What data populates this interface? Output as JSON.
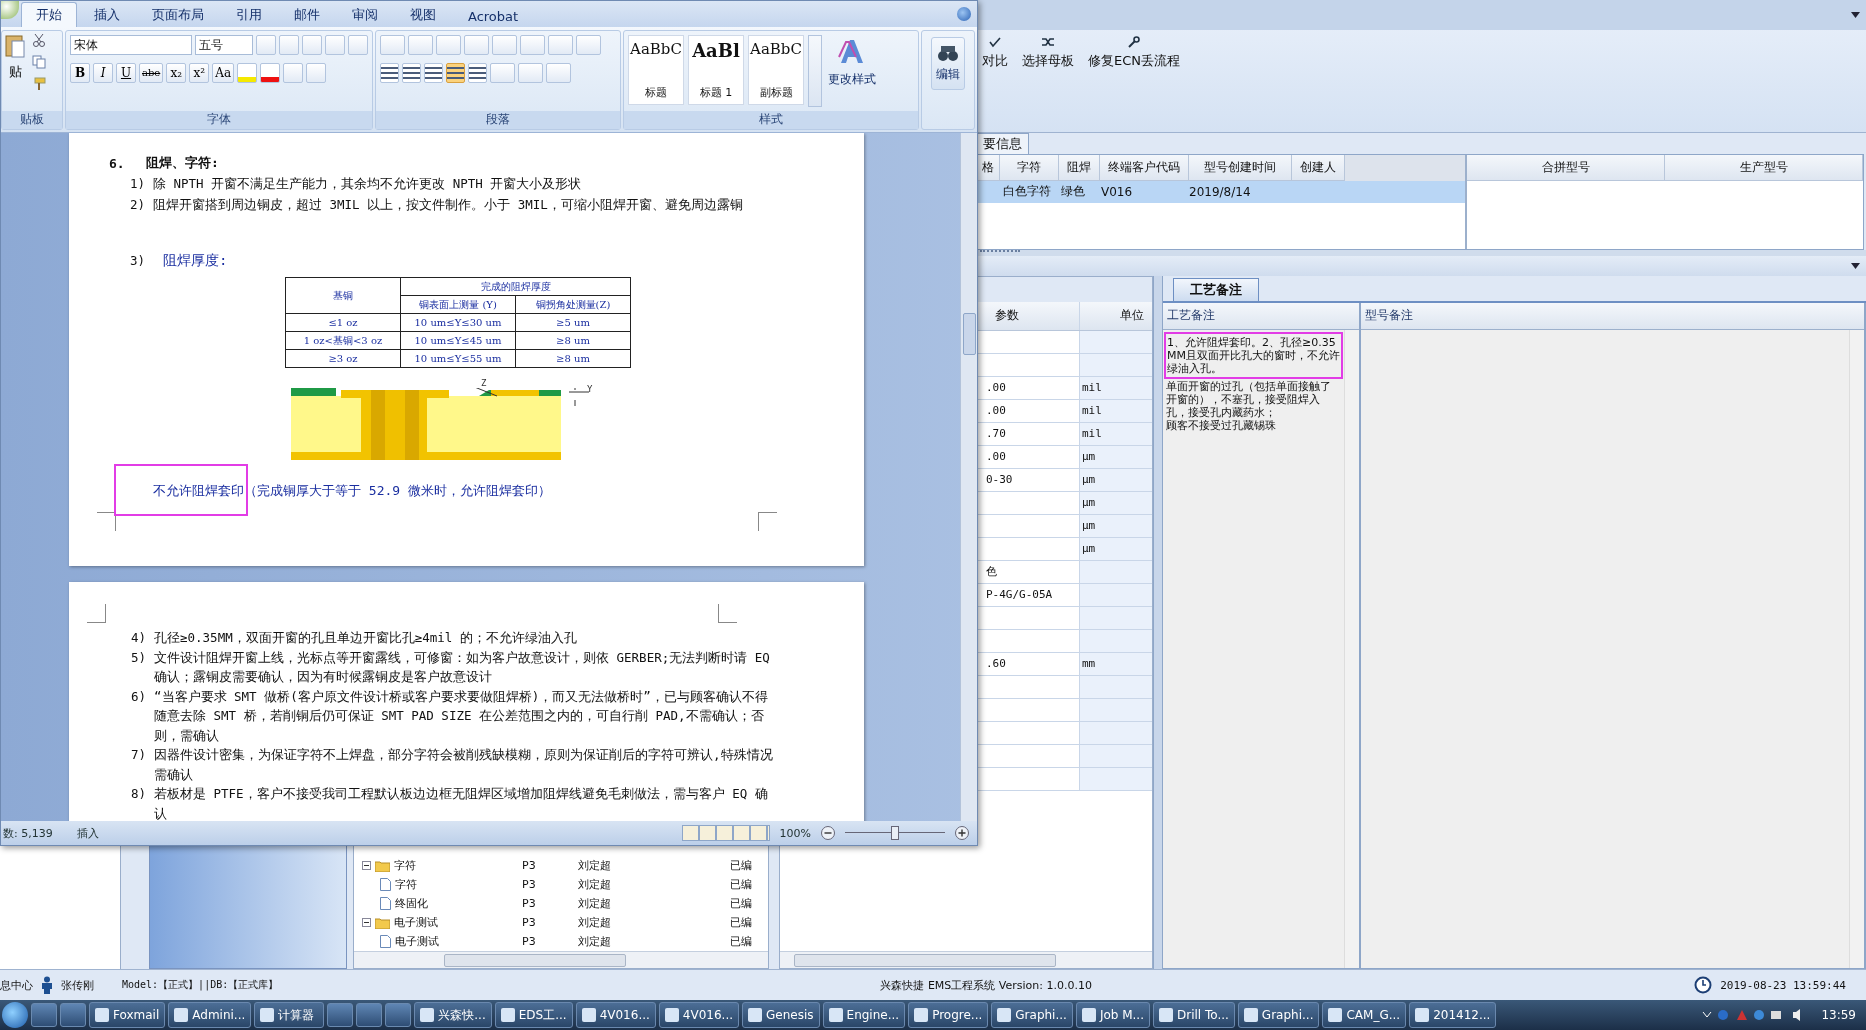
{
  "word": {
    "tabs": [
      {
        "label": "开始",
        "selected": true
      },
      {
        "label": "插入",
        "selected": false
      },
      {
        "label": "页面布局",
        "selected": false
      },
      {
        "label": "引用",
        "selected": false
      },
      {
        "label": "邮件",
        "selected": false
      },
      {
        "label": "审阅",
        "selected": false
      },
      {
        "label": "视图",
        "selected": false
      },
      {
        "label": "Acrobat",
        "selected": false
      }
    ],
    "paste_label": "贴",
    "font_name": "宋体",
    "font_size": "五号",
    "font_buttons": [
      "B",
      "I",
      "U",
      "abe",
      "x₂",
      "x²",
      "Aa"
    ],
    "align_buttons": [
      {
        "selected": false
      },
      {
        "selected": false
      },
      {
        "selected": false
      },
      {
        "selected": true
      },
      {
        "selected": false
      }
    ],
    "styles": [
      {
        "sample": "AaBbC",
        "name": "标题"
      },
      {
        "sample": "AaBl",
        "name": "标题 1"
      },
      {
        "sample": "AaBbC",
        "name": "副标题"
      }
    ],
    "change_styles": "更改样式",
    "edit": "编辑",
    "group_labels": [
      "贴板",
      "字体",
      "段落",
      "样式"
    ],
    "page1": {
      "heading_num": "6.",
      "heading": "阻焊、字符:",
      "items": [
        {
          "num": "1)",
          "text": "除 NPTH 开窗不满足生产能力，其余均不允许更改 NPTH 开窗大小及形状"
        },
        {
          "num": "2)",
          "text": "阻焊开窗搭到周边铜皮，超过 3MIL 以上，按文件制作。小于 3MIL，可缩小阻焊开窗、避免周边露铜"
        }
      ],
      "thickness_num": "3)",
      "thickness": "阻焊厚度:",
      "table": {
        "base_header": "基铜",
        "finish_header": "完成的阻焊厚度",
        "sub_headers": [
          "铜表面上测量 (Y)",
          "铜拐角处测量(Z)"
        ],
        "rows": [
          [
            "≤1 oz",
            "10 um≤Y≤30 um",
            "≥5 um"
          ],
          [
            "1 oz<基铜<3 oz",
            "10 um≤Y≤45 um",
            "≥8 um"
          ],
          [
            "≥3 oz",
            "10 um≤Y≤55 um",
            "≥8 um"
          ]
        ]
      },
      "diagram_labels": [
        "Z",
        "Y"
      ],
      "note": "不允许阻焊套印（完成铜厚大于等于 52.9 微米时，允许阻焊套印）"
    },
    "page2": {
      "items": [
        {
          "num": "4)",
          "text": "孔径≥0.35MM，双面开窗的孔且单边开窗比孔≥4mil 的；不允许绿油入孔"
        },
        {
          "num": "5)",
          "text": "文件设计阻焊开窗上线，光标点等开窗露线，可修窗：如为客户故意设计，则依 GERBER;无法判断时请 EQ 确认；露铜皮需要确认，因为有时候露铜皮是客户故意设计"
        },
        {
          "num": "6)",
          "text": "“当客户要求 SMT 做桥(客户原文件设计桥或客户要求要做阻焊桥)，而又无法做桥时”，已与顾客确认不得随意去除 SMT 桥，若削铜后仍可保证 SMT PAD SIZE 在公差范围之内的，可自行削 PAD,不需确认；否则，需确认"
        },
        {
          "num": "7)",
          "text": "因器件设计密集，为保证字符不上焊盘，部分字符会被削残缺模糊，原则为保证削后的字符可辨认,特殊情况需确认"
        },
        {
          "num": "8)",
          "text": "若板材是 PTFE，客户不接受我司工程默认板边边框无阻焊区域增加阻焊线避免毛刺做法，需与客户 EQ 确认"
        }
      ]
    },
    "status": {
      "words": "数: 5,139",
      "mode": "插入",
      "zoom": "100%",
      "zoom_slider": {
        "level": 0.5
      }
    }
  },
  "app": {
    "toolbar": [
      {
        "label": "对比"
      },
      {
        "label": "选择母板"
      },
      {
        "label": "修复ECN丢流程"
      }
    ],
    "info_tab": "要信息",
    "main_grid": {
      "columns": [
        "格",
        "字符",
        "阻焊",
        "终端客户代码",
        "型号创建时间",
        "创建人"
      ],
      "rows": [
        {
          "cells": [
            null,
            "白色字符",
            "绿色",
            "V016",
            "2019/8/14",
            null
          ],
          "selected": true
        }
      ]
    },
    "side_grid": {
      "columns": [
        "合拼型号",
        "生产型号"
      ]
    },
    "params": {
      "columns": [
        "参数",
        "单位"
      ],
      "rows": [
        {},
        {},
        {
          "value": ".00",
          "unit": "mil"
        },
        {
          "value": ".00",
          "unit": "mil"
        },
        {
          "value": ".70",
          "unit": "mil"
        },
        {
          "value": ".00",
          "unit": "µm"
        },
        {
          "value": "0-30",
          "unit": "µm"
        },
        {
          "unit": "µm"
        },
        {
          "unit": "µm"
        },
        {
          "unit": "µm"
        },
        {
          "value": "色"
        },
        {
          "value": "P-4G/G-05A"
        },
        {},
        {},
        {
          "value": ".60",
          "unit": "mm"
        },
        {},
        {},
        {},
        {},
        {}
      ]
    },
    "notes_tab": "工艺备注",
    "notes": {
      "columns": [
        "工艺备注",
        "型号备注"
      ],
      "lines": [
        "1、允许阻焊套印。2、孔径≥0.35MM且双面开比孔大的窗时，不允许绿油入孔。",
        "单面开窗的过孔（包括单面接触了开窗的），不塞孔，接受阻焊入孔，接受孔内藏药水；",
        "顾客不接受过孔藏锡珠"
      ]
    },
    "tree": [
      {
        "name": "字符",
        "kind": "folder",
        "expanded": true,
        "cells": [
          "P3",
          "刘定超",
          "已编"
        ],
        "children": [
          {
            "name": "字符",
            "kind": "doc",
            "cells": [
              "P3",
              "刘定超",
              "已编"
            ]
          },
          {
            "name": "终固化",
            "kind": "doc",
            "cells": [
              "P3",
              "刘定超",
              "已编"
            ]
          }
        ]
      },
      {
        "name": "电子测试",
        "kind": "folder",
        "expanded": true,
        "cells": [
          "P3",
          "刘定超",
          "已编"
        ],
        "children": [
          {
            "name": "电子测试",
            "kind": "doc",
            "cells": [
              "P3",
              "刘定超",
              "已编"
            ]
          }
        ]
      }
    ],
    "statusbar": {
      "left": "息中心",
      "user": "张传刚",
      "model": "Model:【正式】||DB:【正式库】",
      "system": "兴森快捷 EMS工程系统 Version: 1.0.0.10",
      "time": "2019-08-23 13:59:44"
    }
  },
  "taskbar": {
    "items": [
      {
        "kind": "icon"
      },
      {
        "kind": "icon"
      },
      {
        "kind": "app",
        "label": "Foxmail"
      },
      {
        "kind": "app",
        "label": "Admini..."
      },
      {
        "kind": "app",
        "label": "计算器"
      },
      {
        "kind": "icon"
      },
      {
        "kind": "icon"
      },
      {
        "kind": "icon"
      },
      {
        "kind": "app",
        "label": "兴森快..."
      },
      {
        "kind": "app",
        "label": "EDS工..."
      },
      {
        "kind": "app",
        "label": "4V016..."
      },
      {
        "kind": "app",
        "label": "4V016..."
      },
      {
        "kind": "app",
        "label": "Genesis"
      },
      {
        "kind": "app",
        "label": "Engine..."
      },
      {
        "kind": "app",
        "label": "Progre..."
      },
      {
        "kind": "app",
        "label": "Graphi..."
      },
      {
        "kind": "app",
        "label": "Job M..."
      },
      {
        "kind": "app",
        "label": "Drill To..."
      },
      {
        "kind": "app",
        "label": "Graphi..."
      },
      {
        "kind": "app",
        "label": "CAM_G..."
      },
      {
        "kind": "app",
        "label": "201412..."
      }
    ],
    "clock": "13:59"
  }
}
